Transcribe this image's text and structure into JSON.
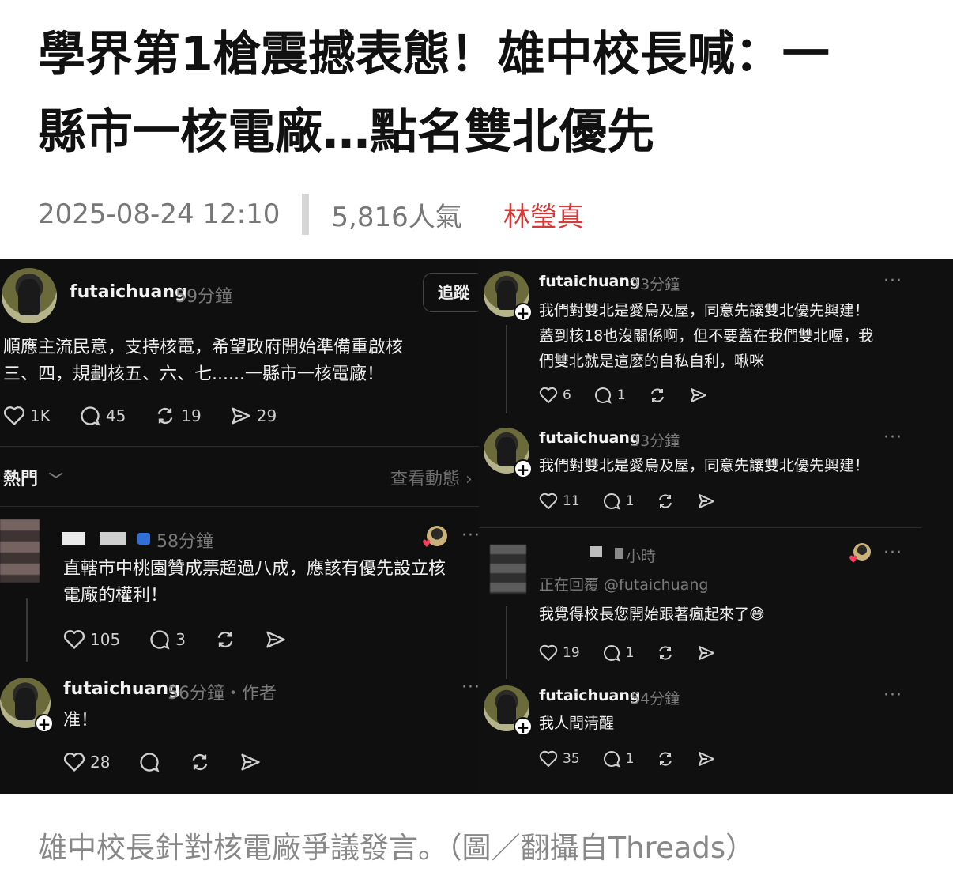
{
  "article": {
    "headline_line1": "學界第1槍震撼表態！雄中校長喊：一",
    "headline_line2": "縣市一核電廠…點名雙北優先",
    "date": "2025-08-24 12:10",
    "views": "5,816人氣",
    "author": "林瑩真",
    "caption": "雄中校長針對核電廠爭議發言。（圖／翻攝自Threads）",
    "colors": {
      "author": "#d33a3a",
      "meta": "#777777",
      "headline": "#111111"
    }
  },
  "left": {
    "post": {
      "username": "futaichuang",
      "time": "59分鐘",
      "follow_label": "追蹤",
      "text_line1": "順應主流民意，支持核電，希望政府開始準備重啟核",
      "text_line2": "三、四，規劃核五、六、七......一縣市一核電廠！",
      "likes": "1K",
      "comments": "45",
      "reposts": "19",
      "shares": "29"
    },
    "tabs": {
      "hot": "熱門",
      "activity": "查看動態"
    },
    "reply1": {
      "time": "58分鐘",
      "text_line1": "直轄市中桃園贊成票超過八成，應該有優先設立核",
      "text_line2": "電廠的權利！",
      "likes": "105",
      "comments": "3"
    },
    "reply2": {
      "username": "futaichuang",
      "time": "56分鐘・作者",
      "text": "准！",
      "likes": "28"
    }
  },
  "right": {
    "r1": {
      "username": "futaichuang",
      "time": "33分鐘",
      "text_line1": "我們對雙北是愛烏及屋，同意先讓雙北優先興建！",
      "text_line2": "蓋到核18也沒關係啊，但不要蓋在我們雙北喔，我",
      "text_line3": "們雙北就是這麼的自私自利，啾咪",
      "likes": "6",
      "comments": "1"
    },
    "r2": {
      "username": "futaichuang",
      "time": "33分鐘",
      "text": "我們對雙北是愛烏及屋，同意先讓雙北優先興建！",
      "likes": "11",
      "comments": "1"
    },
    "r3": {
      "username_suffix": "小時",
      "replying": "正在回覆 @futaichuang",
      "text": "我覺得校長您開始跟著瘋起來了😅",
      "likes": "19",
      "comments": "1"
    },
    "r4": {
      "username": "futaichuang",
      "time": "54分鐘",
      "text": "我人間清醒",
      "likes": "35",
      "comments": "1"
    }
  }
}
